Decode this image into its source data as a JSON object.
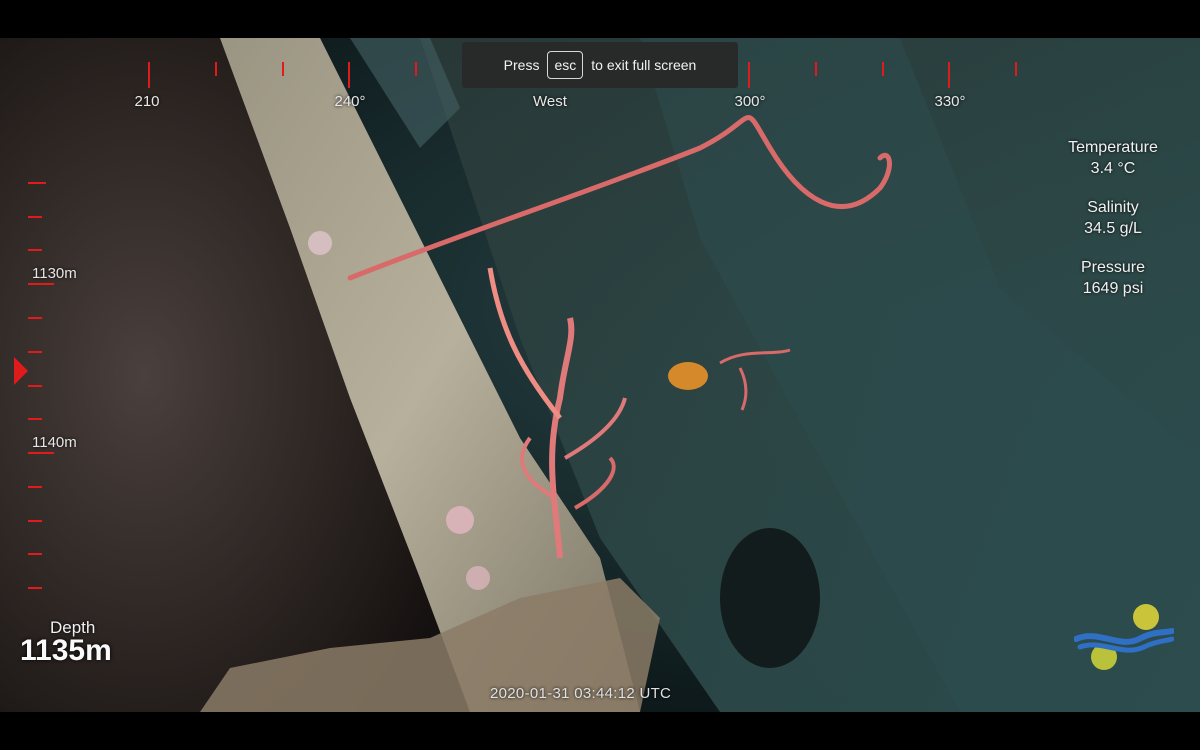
{
  "fullscreen_notice": {
    "press": "Press",
    "key": "esc",
    "suffix": "to exit full screen"
  },
  "compass": {
    "labels": [
      "210",
      "240°",
      "West",
      "300°",
      "330°"
    ]
  },
  "depth_scale": {
    "labels": [
      "1130m",
      "1140m"
    ]
  },
  "sensors": {
    "temperature": {
      "label": "Temperature",
      "value": "3.4 °C"
    },
    "salinity": {
      "label": "Salinity",
      "value": "34.5 g/L"
    },
    "pressure": {
      "label": "Pressure",
      "value": "1649 psi"
    }
  },
  "depth": {
    "caption": "Depth",
    "value": "1135m"
  },
  "timestamp": "2020-01-31 03:44:12 UTC",
  "colors": {
    "overlay_red": "#e01b1b",
    "logo_blue": "#2f6fc4",
    "logo_yellow": "#c9c43a"
  }
}
